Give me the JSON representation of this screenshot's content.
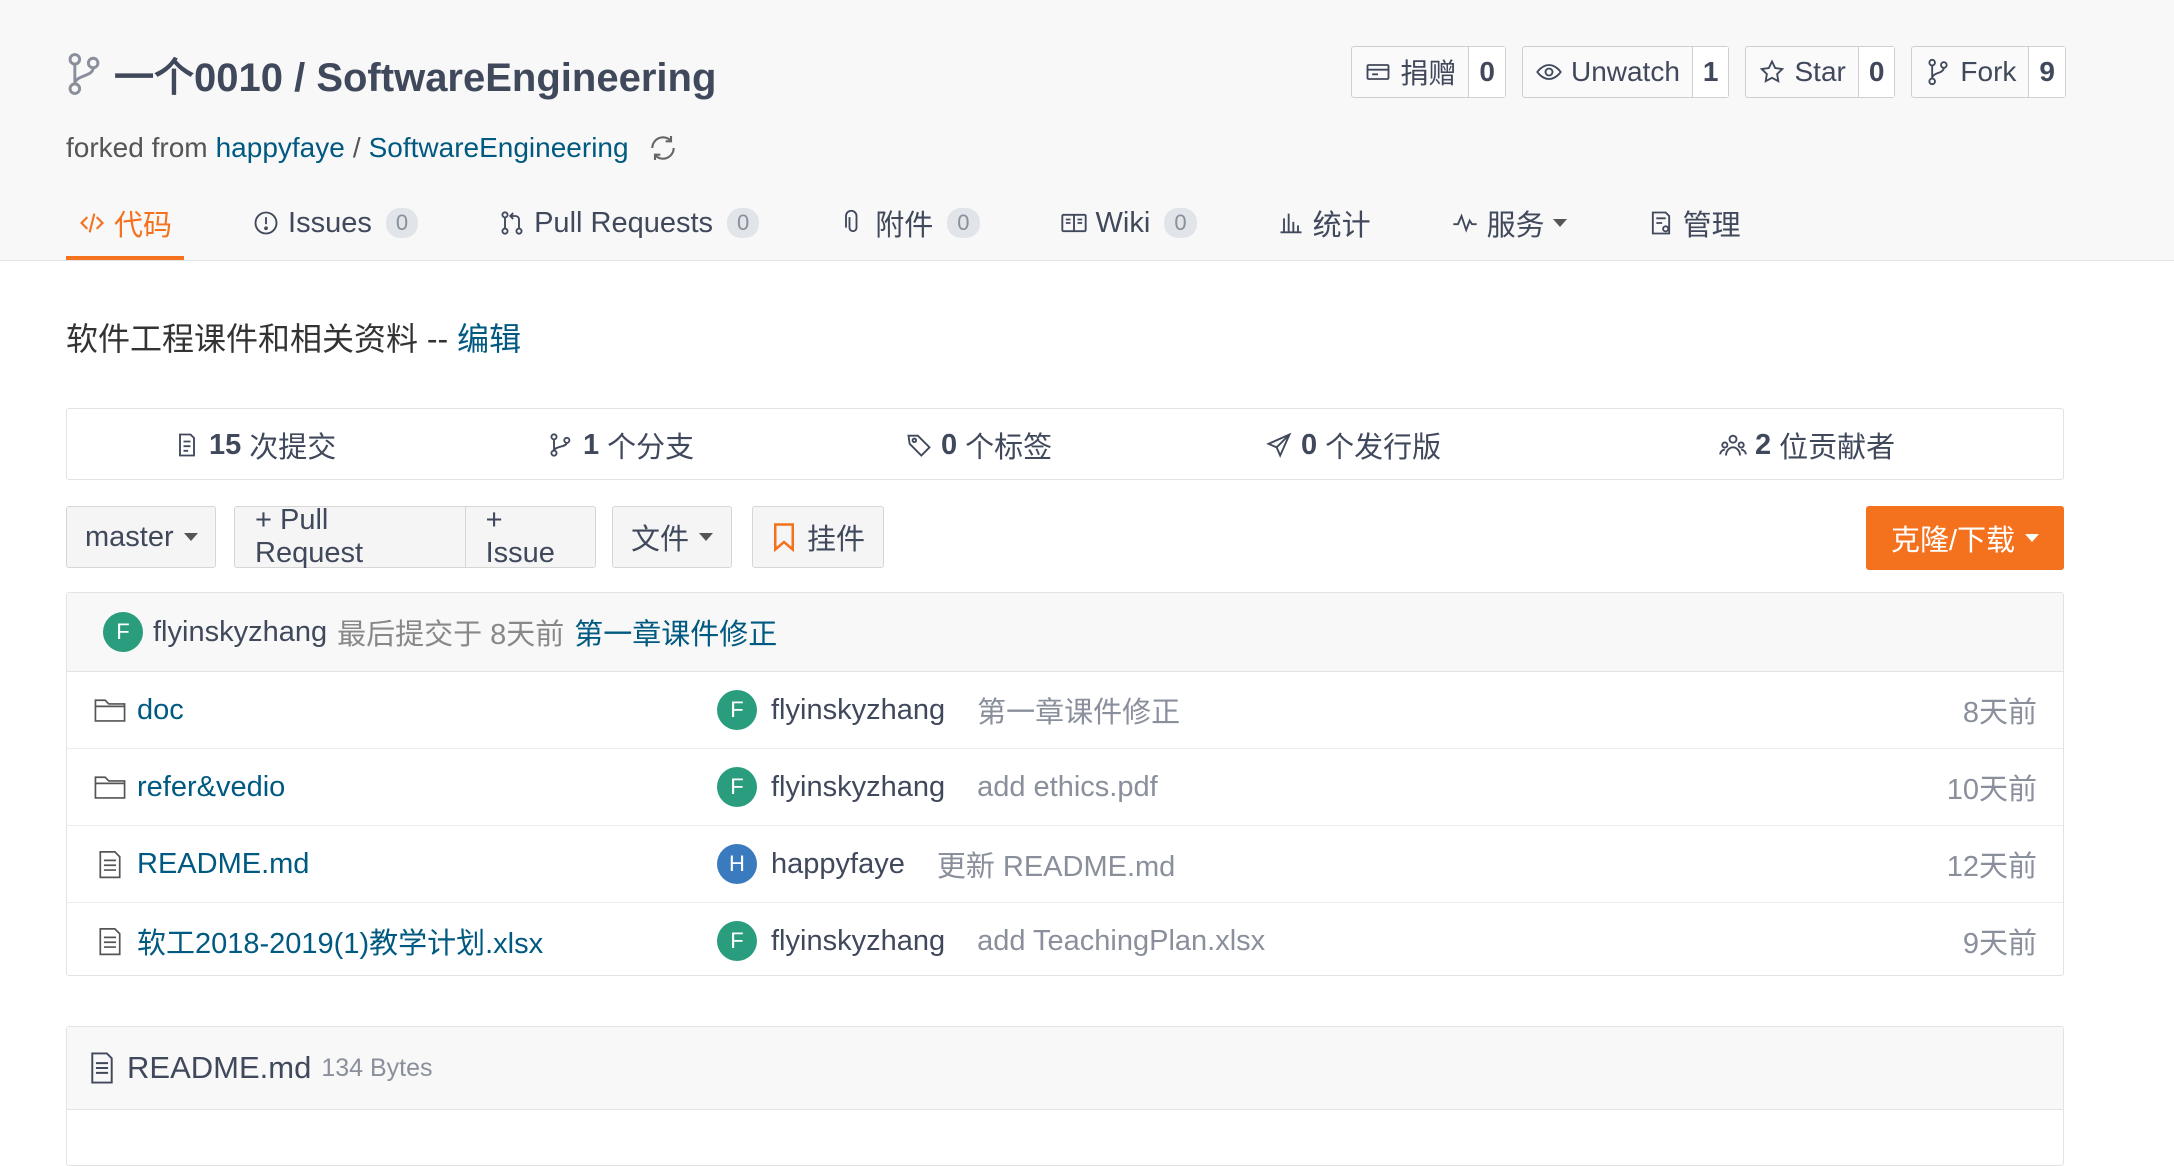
{
  "repo": {
    "title": "一个0010 / SoftwareEngineering",
    "forked_prefix": "forked from",
    "fork_owner": "happyfaye",
    "fork_sep": "/",
    "fork_repo": "SoftwareEngineering"
  },
  "actions": [
    {
      "label": "捐赠",
      "count": "0",
      "icon": "donate-icon"
    },
    {
      "label": "Unwatch",
      "count": "1",
      "icon": "eye-icon"
    },
    {
      "label": "Star",
      "count": "0",
      "icon": "star-icon"
    },
    {
      "label": "Fork",
      "count": "9",
      "icon": "fork-icon"
    }
  ],
  "tabs": [
    {
      "label": "代码",
      "icon": "code-icon",
      "active": true
    },
    {
      "label": "Issues",
      "badge": "0",
      "icon": "issue-icon"
    },
    {
      "label": "Pull Requests",
      "badge": "0",
      "icon": "pull-request-icon"
    },
    {
      "label": "附件",
      "badge": "0",
      "icon": "paperclip-icon"
    },
    {
      "label": "Wiki",
      "badge": "0",
      "icon": "book-icon"
    },
    {
      "label": "统计",
      "icon": "bar-chart-icon"
    },
    {
      "label": "服务",
      "icon": "pulse-icon"
    },
    {
      "label": "管理",
      "icon": "settings-doc-icon"
    }
  ],
  "description": {
    "text": "软件工程课件和相关资料 --",
    "edit": "编辑"
  },
  "stats": [
    {
      "num": "15",
      "label": "次提交",
      "icon": "commit-icon"
    },
    {
      "num": "1",
      "label": "个分支",
      "icon": "branch-icon"
    },
    {
      "num": "0",
      "label": "个标签",
      "icon": "tag-icon"
    },
    {
      "num": "0",
      "label": "个发行版",
      "icon": "release-icon"
    },
    {
      "num": "2",
      "label": "位贡献者",
      "icon": "contributors-icon"
    }
  ],
  "toolbar": {
    "branch": "master",
    "pull_request": "+ Pull Request",
    "issue": "+ Issue",
    "file": "文件",
    "widget": "挂件",
    "clone": "克隆/下载"
  },
  "latest_commit": {
    "avatar": "F",
    "author": "flyinskyzhang",
    "meta": "最后提交于 8天前",
    "message": "第一章课件修正"
  },
  "files": [
    {
      "name": "doc",
      "type": "folder",
      "avatar": "F",
      "author": "flyinskyzhang",
      "message": "第一章课件修正",
      "time": "8天前"
    },
    {
      "name": "refer&vedio",
      "type": "folder",
      "avatar": "F",
      "author": "flyinskyzhang",
      "message": "add ethics.pdf",
      "time": "10天前"
    },
    {
      "name": "README.md",
      "type": "file",
      "avatar": "H",
      "author": "happyfaye",
      "message": "更新 README.md",
      "time": "12天前"
    },
    {
      "name": "软工2018-2019(1)教学计划.xlsx",
      "type": "file",
      "avatar": "F",
      "author": "flyinskyzhang",
      "message": "add TeachingPlan.xlsx",
      "time": "9天前"
    }
  ],
  "readme": {
    "name": "README.md",
    "size": "134 Bytes"
  }
}
